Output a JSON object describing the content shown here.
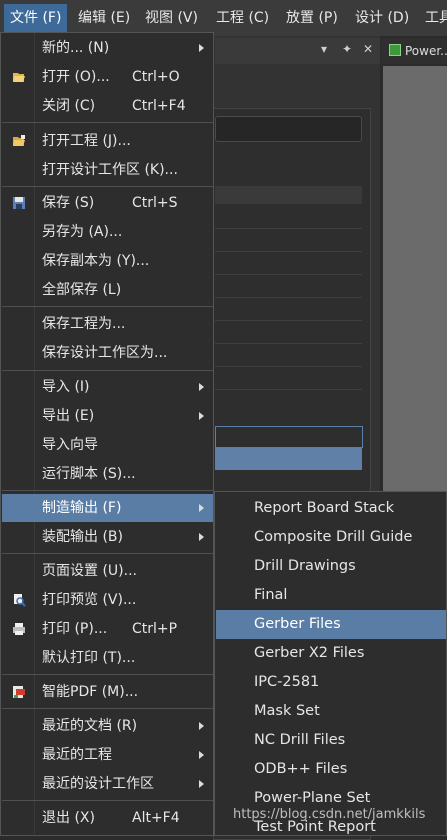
{
  "menubar": {
    "items": [
      {
        "label": "文件 (F)"
      },
      {
        "label": "编辑 (E)"
      },
      {
        "label": "视图 (V)"
      },
      {
        "label": "工程 (C)"
      },
      {
        "label": "放置 (P)"
      },
      {
        "label": "设计 (D)"
      },
      {
        "label": "工具"
      }
    ]
  },
  "background": {
    "doc_tab_label": "Power...",
    "tab_controls": [
      "▾",
      "✦",
      "✕"
    ]
  },
  "file_menu": {
    "items": [
      {
        "label": "新的... (N)",
        "shortcut": "",
        "has_submenu": true,
        "icon": ""
      },
      {
        "label": "打开 (O)...",
        "shortcut": "Ctrl+O",
        "has_submenu": false,
        "icon": "open-folder-icon"
      },
      {
        "label": "关闭 (C)",
        "shortcut": "Ctrl+F4",
        "has_submenu": false,
        "icon": ""
      },
      {
        "label": "打开工程 (J)...",
        "shortcut": "",
        "has_submenu": false,
        "icon": "open-project-icon"
      },
      {
        "label": "打开设计工作区 (K)...",
        "shortcut": "",
        "has_submenu": false,
        "icon": ""
      },
      {
        "label": "保存 (S)",
        "shortcut": "Ctrl+S",
        "has_submenu": false,
        "icon": "save-disk-icon"
      },
      {
        "label": "另存为 (A)...",
        "shortcut": "",
        "has_submenu": false,
        "icon": ""
      },
      {
        "label": "保存副本为 (Y)...",
        "shortcut": "",
        "has_submenu": false,
        "icon": ""
      },
      {
        "label": "全部保存 (L)",
        "shortcut": "",
        "has_submenu": false,
        "icon": ""
      },
      {
        "label": "保存工程为...",
        "shortcut": "",
        "has_submenu": false,
        "icon": ""
      },
      {
        "label": "保存设计工作区为...",
        "shortcut": "",
        "has_submenu": false,
        "icon": ""
      },
      {
        "label": "导入 (I)",
        "shortcut": "",
        "has_submenu": true,
        "icon": ""
      },
      {
        "label": "导出 (E)",
        "shortcut": "",
        "has_submenu": true,
        "icon": ""
      },
      {
        "label": "导入向导",
        "shortcut": "",
        "has_submenu": false,
        "icon": ""
      },
      {
        "label": "运行脚本 (S)...",
        "shortcut": "",
        "has_submenu": false,
        "icon": ""
      },
      {
        "label": "制造输出 (F)",
        "shortcut": "",
        "has_submenu": true,
        "icon": "",
        "selected": true
      },
      {
        "label": "装配输出 (B)",
        "shortcut": "",
        "has_submenu": true,
        "icon": ""
      },
      {
        "label": "页面设置 (U)...",
        "shortcut": "",
        "has_submenu": false,
        "icon": ""
      },
      {
        "label": "打印预览 (V)...",
        "shortcut": "",
        "has_submenu": false,
        "icon": "print-preview-icon"
      },
      {
        "label": "打印 (P)...",
        "shortcut": "Ctrl+P",
        "has_submenu": false,
        "icon": "printer-icon"
      },
      {
        "label": "默认打印 (T)...",
        "shortcut": "",
        "has_submenu": false,
        "icon": ""
      },
      {
        "label": "智能PDF (M)...",
        "shortcut": "",
        "has_submenu": false,
        "icon": "smart-pdf-icon"
      },
      {
        "label": "最近的文档 (R)",
        "shortcut": "",
        "has_submenu": true,
        "icon": ""
      },
      {
        "label": "最近的工程",
        "shortcut": "",
        "has_submenu": true,
        "icon": ""
      },
      {
        "label": "最近的设计工作区",
        "shortcut": "",
        "has_submenu": true,
        "icon": ""
      },
      {
        "label": "退出 (X)",
        "shortcut": "Alt+F4",
        "has_submenu": false,
        "icon": ""
      }
    ]
  },
  "fabrication_submenu": {
    "items": [
      {
        "label": "Report Board Stack"
      },
      {
        "label": "Composite Drill Guide"
      },
      {
        "label": "Drill Drawings"
      },
      {
        "label": "Final"
      },
      {
        "label": "Gerber Files",
        "selected": true
      },
      {
        "label": "Gerber X2 Files"
      },
      {
        "label": "IPC-2581"
      },
      {
        "label": "Mask Set"
      },
      {
        "label": "NC Drill Files"
      },
      {
        "label": "ODB++ Files"
      },
      {
        "label": "Power-Plane Set"
      },
      {
        "label": "Test Point Report"
      }
    ]
  },
  "watermark": "https://blog.csdn.net/jamkkils",
  "colors": {
    "menu_bg": "#2d2d2d",
    "highlight": "#5a7da6",
    "menubar_active": "#3e6a99",
    "text": "#e6e6e6"
  }
}
